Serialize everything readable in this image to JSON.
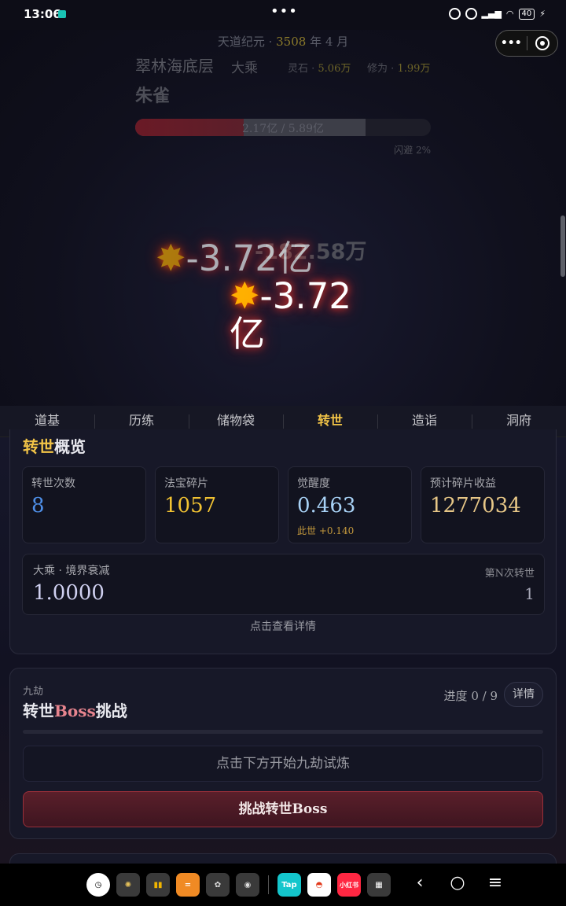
{
  "status_bar": {
    "time": "13:06",
    "dots": "•••",
    "battery": "40"
  },
  "battle": {
    "calendar_prefix": "天道纪元 · ",
    "calendar_year": "3508",
    "calendar_suffix": " 年 4 月",
    "location": "翠林海底层",
    "realm": "大乘",
    "spirit_stone_label": "灵石 · ",
    "spirit_stone_value": "5.06万",
    "cultivation_label": "修为 · ",
    "cultivation_value": "1.99万",
    "enemy_name": "朱雀",
    "hp_text": "2.17亿 / 5.89亿",
    "hp_fraction": 0.368,
    "dodge": "闪避 2%",
    "ghost_damage": "-182.58万",
    "damage_1": "-3.72亿",
    "damage_2": "-3.72亿",
    "burst_icon": "explosion-icon"
  },
  "tabs": [
    {
      "label": "道基",
      "active": false
    },
    {
      "label": "历练",
      "active": false
    },
    {
      "label": "储物袋",
      "active": false
    },
    {
      "label": "转世",
      "active": true
    },
    {
      "label": "造诣",
      "active": false
    },
    {
      "label": "洞府",
      "active": false
    }
  ],
  "overview": {
    "title_highlight": "转世",
    "title_rest": "概览",
    "stats": [
      {
        "label": "转世次数",
        "value": "8"
      },
      {
        "label": "法宝碎片",
        "value": "1057"
      },
      {
        "label": "觉醒度",
        "value": "0.463",
        "sub": "此世 +0.140"
      },
      {
        "label": "预计碎片收益",
        "value": "1277034"
      }
    ],
    "decay_label": "大乘 · 境界衰减",
    "decay_value": "1.0000",
    "nth_label": "第N次转世",
    "nth_value": "1",
    "detail_link": "点击查看详情"
  },
  "boss": {
    "kicker": "九劫",
    "title_a": "转世",
    "title_boss": "Boss",
    "title_b": "挑战",
    "progress": "进度 0 / 9",
    "detail_button": "详情",
    "hint": "点击下方开始九劫试炼",
    "challenge_button": "挑战转世Boss"
  },
  "navbar": {
    "dock_apps": [
      "clock",
      "gallery",
      "music",
      "calculator",
      "settings",
      "camera",
      "Tap",
      "app",
      "小红书",
      "scan"
    ]
  },
  "colors": {
    "accent_gold": "#f1c347",
    "danger_red": "#9a2f3a"
  }
}
